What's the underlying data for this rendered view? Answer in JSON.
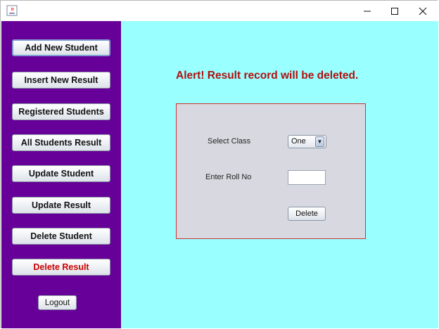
{
  "window": {
    "controls": {
      "minimize": "—",
      "maximize": "☐",
      "close": "✕"
    }
  },
  "sidebar": {
    "items": [
      {
        "label": "Add New Student",
        "color": "#111111"
      },
      {
        "label": "Insert New Result",
        "color": "#111111"
      },
      {
        "label": "Registered Students",
        "color": "#111111"
      },
      {
        "label": "All Students Result",
        "color": "#111111"
      },
      {
        "label": "Update Student",
        "color": "#111111"
      },
      {
        "label": "Update Result",
        "color": "#111111"
      },
      {
        "label": "Delete Student",
        "color": "#111111"
      },
      {
        "label": "Delete Result",
        "color": "#cc0000"
      }
    ],
    "logout_label": "Logout",
    "background": "#660099"
  },
  "main": {
    "background": "#99ffff",
    "alert_text": "Alert! Result record will be deleted.",
    "form": {
      "select_class_label": "Select Class",
      "class_selected": "One",
      "roll_label": "Enter Roll No",
      "roll_value": "",
      "delete_label": "Delete"
    }
  }
}
